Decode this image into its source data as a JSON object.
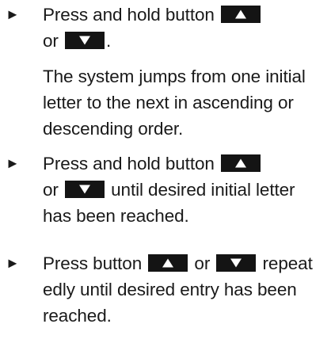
{
  "document": {
    "steps": [
      {
        "bullet": "►",
        "line1": {
          "before": "Press and hold button ",
          "key": "up-arrow",
          "after": ""
        },
        "line2": {
          "before": "or ",
          "key": "down-arrow",
          "after": "."
        }
      },
      {
        "note_lines": [
          "The system jumps from one initial",
          "letter to the next in ascending or",
          "descending order."
        ]
      },
      {
        "bullet": "►",
        "line1": {
          "before": "Press and hold button ",
          "key": "up-arrow",
          "after": ""
        },
        "line2": {
          "before": "or ",
          "key": "down-arrow",
          "after": " until desired initial letter"
        },
        "line3": "has been reached."
      },
      {
        "bullet": "►",
        "line1": {
          "before": "Press button ",
          "key1": "up-arrow",
          "middle": " or ",
          "key2": "down-arrow",
          "after": " repeat"
        },
        "line2": "edly until desired entry has been",
        "line3": "reached."
      }
    ]
  },
  "colors": {
    "key_background": "#141414",
    "key_glyph": "#ffffff",
    "text": "#1a1a1a"
  }
}
